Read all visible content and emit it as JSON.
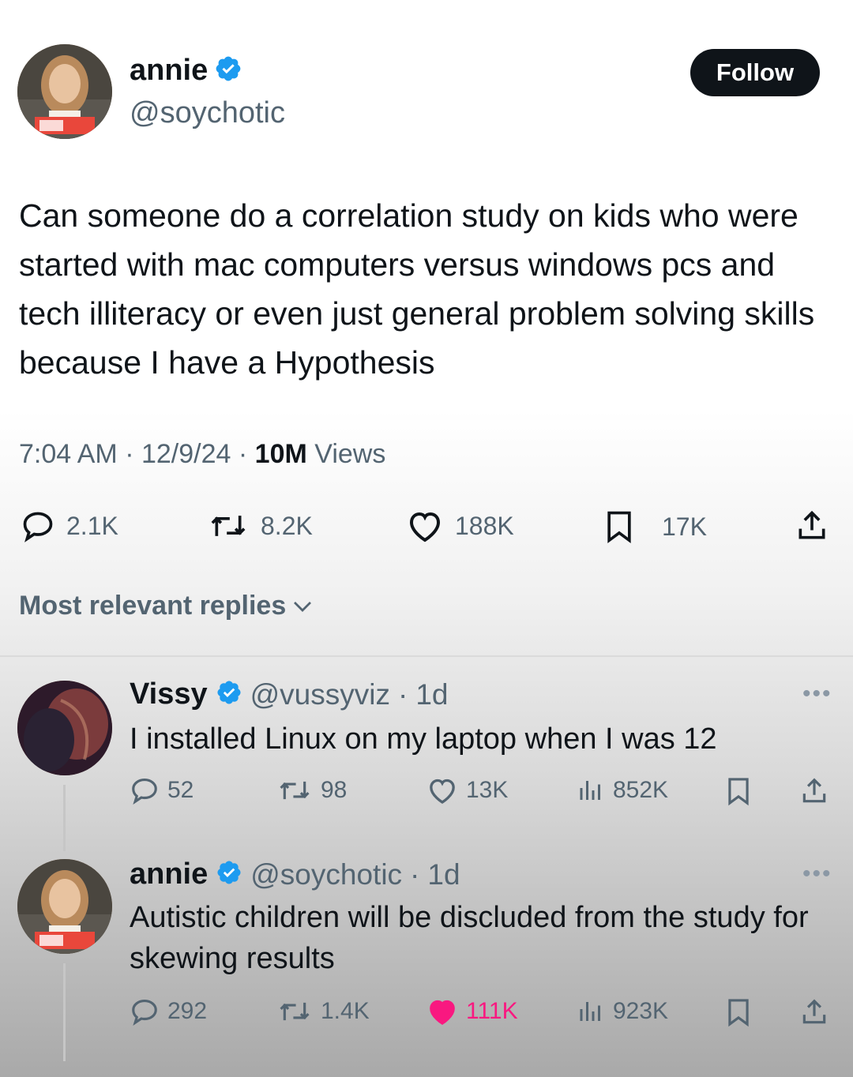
{
  "tweet": {
    "author_name": "annie",
    "author_handle": "@soychotic",
    "follow_label": "Follow",
    "text": "Can someone do a correlation study on kids who were started with mac computers versus windows pcs and tech illiteracy or even just general problem solving skills because I have a Hypothesis",
    "time": "7:04 AM",
    "date": "12/9/24",
    "views_count": "10M",
    "views_label": "Views",
    "actions": {
      "replies": "2.1K",
      "retweets": "8.2K",
      "likes": "188K",
      "bookmarks": "17K"
    }
  },
  "replies_section": {
    "label": "Most relevant replies"
  },
  "replies": [
    {
      "name": "Vissy",
      "handle": "@vussyviz",
      "age": "1d",
      "text": "I installed Linux on my laptop when I was 12",
      "replies": "52",
      "retweets": "98",
      "likes": "13K",
      "views": "852K",
      "liked": false
    },
    {
      "name": "annie",
      "handle": "@soychotic",
      "age": "1d",
      "text": "Autistic children will be discluded from the study for skewing results",
      "replies": "292",
      "retweets": "1.4K",
      "likes": "111K",
      "views": "923K",
      "liked": true
    }
  ],
  "colors": {
    "verified": "#1d9bf0",
    "like_active": "#f91880",
    "secondary_text": "#536471"
  },
  "icons": [
    "verified-badge-icon",
    "reply-icon",
    "retweet-icon",
    "like-icon",
    "bookmark-icon",
    "share-icon",
    "views-icon",
    "chevron-down-icon",
    "more-icon"
  ]
}
